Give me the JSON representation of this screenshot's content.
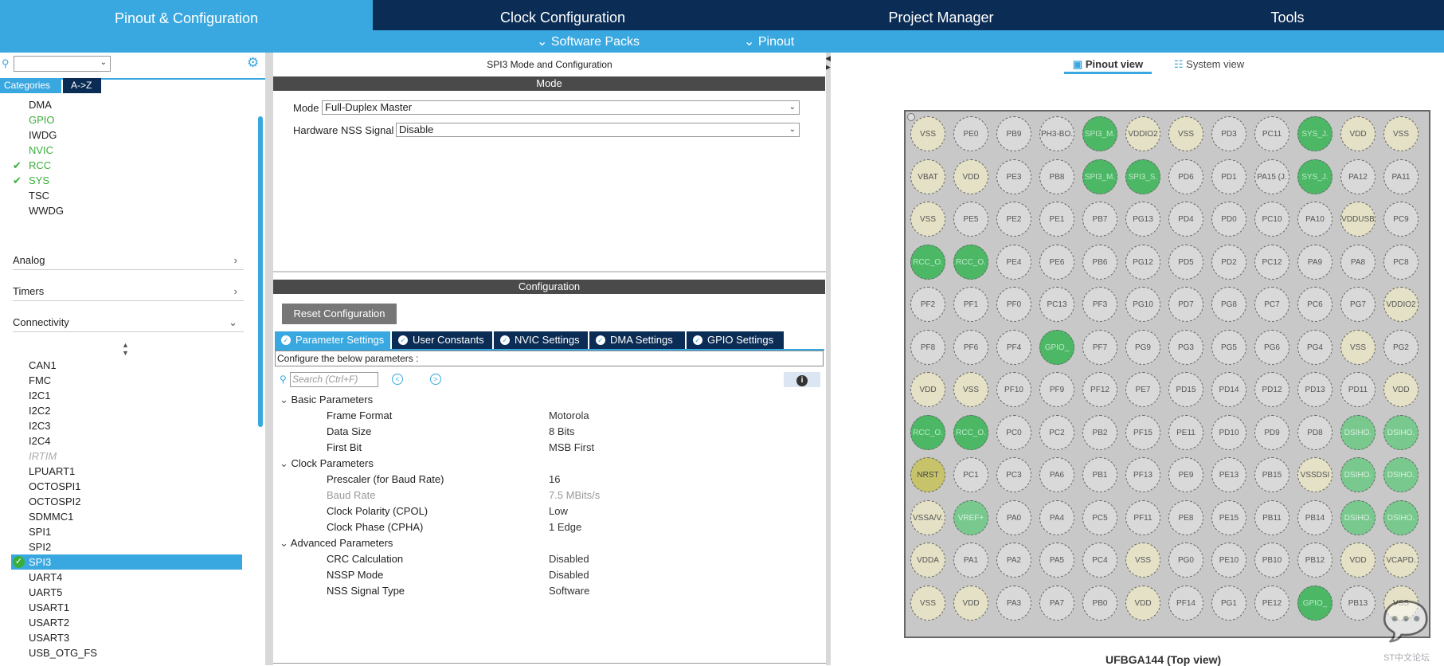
{
  "nav": {
    "tabs": [
      "Pinout & Configuration",
      "Clock Configuration",
      "Project Manager",
      "Tools"
    ],
    "sub": [
      "Software Packs",
      "Pinout"
    ]
  },
  "left": {
    "search_value": "",
    "cat_tab": "Categories",
    "az_tab": "A->Z",
    "system_items": [
      {
        "label": "DMA",
        "state": "normal"
      },
      {
        "label": "GPIO",
        "state": "green"
      },
      {
        "label": "IWDG",
        "state": "normal"
      },
      {
        "label": "NVIC",
        "state": "green"
      },
      {
        "label": "RCC",
        "state": "checked"
      },
      {
        "label": "SYS",
        "state": "checked"
      },
      {
        "label": "TSC",
        "state": "normal"
      },
      {
        "label": "WWDG",
        "state": "normal"
      }
    ],
    "sections": [
      "Analog",
      "Timers",
      "Connectivity"
    ],
    "connectivity_items": [
      {
        "label": "CAN1",
        "state": "normal"
      },
      {
        "label": "FMC",
        "state": "normal"
      },
      {
        "label": "I2C1",
        "state": "normal"
      },
      {
        "label": "I2C2",
        "state": "normal"
      },
      {
        "label": "I2C3",
        "state": "normal"
      },
      {
        "label": "I2C4",
        "state": "normal"
      },
      {
        "label": "IRTIM",
        "state": "disabled"
      },
      {
        "label": "LPUART1",
        "state": "normal"
      },
      {
        "label": "OCTOSPI1",
        "state": "normal"
      },
      {
        "label": "OCTOSPI2",
        "state": "normal"
      },
      {
        "label": "SDMMC1",
        "state": "normal"
      },
      {
        "label": "SPI1",
        "state": "normal"
      },
      {
        "label": "SPI2",
        "state": "normal"
      },
      {
        "label": "SPI3",
        "state": "selected"
      },
      {
        "label": "UART4",
        "state": "normal"
      },
      {
        "label": "UART5",
        "state": "normal"
      },
      {
        "label": "USART1",
        "state": "normal"
      },
      {
        "label": "USART2",
        "state": "normal"
      },
      {
        "label": "USART3",
        "state": "normal"
      },
      {
        "label": "USB_OTG_FS",
        "state": "normal"
      }
    ]
  },
  "mid": {
    "title": "SPI3 Mode and Configuration",
    "mode_bar": "Mode",
    "mode_label": "Mode",
    "mode_value": "Full-Duplex Master",
    "nss_label": "Hardware NSS Signal",
    "nss_value": "Disable",
    "config_bar": "Configuration",
    "reset_button": "Reset Configuration",
    "tabs": [
      "Parameter Settings",
      "User Constants",
      "NVIC Settings",
      "DMA Settings",
      "GPIO Settings"
    ],
    "configure_text": "Configure the below parameters :",
    "search_placeholder": "Search (Ctrl+F)",
    "groups": [
      {
        "name": "Basic Parameters",
        "params": [
          {
            "name": "Frame Format",
            "value": "Motorola",
            "dim": false
          },
          {
            "name": "Data Size",
            "value": "8 Bits",
            "dim": false
          },
          {
            "name": "First Bit",
            "value": "MSB First",
            "dim": false
          }
        ]
      },
      {
        "name": "Clock Parameters",
        "params": [
          {
            "name": "Prescaler (for Baud Rate)",
            "value": "16",
            "dim": false
          },
          {
            "name": "Baud Rate",
            "value": "7.5 MBits/s",
            "dim": true
          },
          {
            "name": "Clock Polarity (CPOL)",
            "value": "Low",
            "dim": false
          },
          {
            "name": "Clock Phase (CPHA)",
            "value": "1 Edge",
            "dim": false
          }
        ]
      },
      {
        "name": "Advanced Parameters",
        "params": [
          {
            "name": "CRC Calculation",
            "value": "Disabled",
            "dim": false
          },
          {
            "name": "NSSP Mode",
            "value": "Disabled",
            "dim": false
          },
          {
            "name": "NSS Signal Type",
            "value": "Software",
            "dim": false
          }
        ]
      }
    ]
  },
  "right": {
    "pinout_view": "Pinout view",
    "system_view": "System view",
    "package_label": "UFBGA144 (Top view)",
    "watermark": "ST中文论坛",
    "pins": [
      [
        [
          "VSS",
          "y"
        ],
        [
          "PE0",
          "g"
        ],
        [
          "PB9",
          "g"
        ],
        [
          "PH3-BO.",
          "g"
        ],
        [
          "SPI3_M.",
          "s"
        ],
        [
          "VDDIO2",
          "y"
        ],
        [
          "VSS",
          "y"
        ],
        [
          "PD3",
          "g"
        ],
        [
          "PC11",
          "g"
        ],
        [
          "SYS_J.",
          "s"
        ],
        [
          "VDD",
          "y"
        ],
        [
          "VSS",
          "y"
        ]
      ],
      [
        [
          "VBAT",
          "y"
        ],
        [
          "VDD",
          "y"
        ],
        [
          "PE3",
          "g"
        ],
        [
          "PB8",
          "g"
        ],
        [
          "SPI3_M.",
          "s"
        ],
        [
          "SPI3_S.",
          "s"
        ],
        [
          "PD6",
          "g"
        ],
        [
          "PD1",
          "g"
        ],
        [
          "PA15 (J.",
          "g"
        ],
        [
          "SYS_J.",
          "s"
        ],
        [
          "PA12",
          "g"
        ],
        [
          "PA11",
          "g"
        ]
      ],
      [
        [
          "VSS",
          "y"
        ],
        [
          "PE5",
          "g"
        ],
        [
          "PE2",
          "g"
        ],
        [
          "PE1",
          "g"
        ],
        [
          "PB7",
          "g"
        ],
        [
          "PG13",
          "g"
        ],
        [
          "PD4",
          "g"
        ],
        [
          "PD0",
          "g"
        ],
        [
          "PC10",
          "g"
        ],
        [
          "PA10",
          "g"
        ],
        [
          "VDDUSB",
          "y"
        ],
        [
          "PC9",
          "g"
        ]
      ],
      [
        [
          "RCC_O.",
          "s"
        ],
        [
          "RCC_O.",
          "s"
        ],
        [
          "PE4",
          "g"
        ],
        [
          "PE6",
          "g"
        ],
        [
          "PB6",
          "g"
        ],
        [
          "PG12",
          "g"
        ],
        [
          "PD5",
          "g"
        ],
        [
          "PD2",
          "g"
        ],
        [
          "PC12",
          "g"
        ],
        [
          "PA9",
          "g"
        ],
        [
          "PA8",
          "g"
        ],
        [
          "PC8",
          "g"
        ]
      ],
      [
        [
          "PF2",
          "g"
        ],
        [
          "PF1",
          "g"
        ],
        [
          "PF0",
          "g"
        ],
        [
          "PC13",
          "g"
        ],
        [
          "PF3",
          "g"
        ],
        [
          "PG10",
          "g"
        ],
        [
          "PD7",
          "g"
        ],
        [
          "PG8",
          "g"
        ],
        [
          "PC7",
          "g"
        ],
        [
          "PC6",
          "g"
        ],
        [
          "PG7",
          "g"
        ],
        [
          "VDDIO2",
          "y"
        ]
      ],
      [
        [
          "PF8",
          "g"
        ],
        [
          "PF6",
          "g"
        ],
        [
          "PF4",
          "g"
        ],
        [
          "GPIO_",
          "s"
        ],
        [
          "PF7",
          "g"
        ],
        [
          "PG9",
          "g"
        ],
        [
          "PG3",
          "g"
        ],
        [
          "PG5",
          "g"
        ],
        [
          "PG6",
          "g"
        ],
        [
          "PG4",
          "g"
        ],
        [
          "VSS",
          "y"
        ],
        [
          "PG2",
          "g"
        ]
      ],
      [
        [
          "VDD",
          "y"
        ],
        [
          "VSS",
          "y"
        ],
        [
          "PF10",
          "g"
        ],
        [
          "PF9",
          "g"
        ],
        [
          "PF12",
          "g"
        ],
        [
          "PE7",
          "g"
        ],
        [
          "PD15",
          "g"
        ],
        [
          "PD14",
          "g"
        ],
        [
          "PD12",
          "g"
        ],
        [
          "PD13",
          "g"
        ],
        [
          "PD11",
          "g"
        ],
        [
          "VDD",
          "y"
        ]
      ],
      [
        [
          "RCC_O.",
          "s"
        ],
        [
          "RCC_O.",
          "s"
        ],
        [
          "PC0",
          "g"
        ],
        [
          "PC2",
          "g"
        ],
        [
          "PB2",
          "g"
        ],
        [
          "PF15",
          "g"
        ],
        [
          "PE11",
          "g"
        ],
        [
          "PD10",
          "g"
        ],
        [
          "PD9",
          "g"
        ],
        [
          "PD8",
          "g"
        ],
        [
          "DSIHO.",
          "l"
        ],
        [
          "DSIHO.",
          "l"
        ]
      ],
      [
        [
          "NRST",
          "o"
        ],
        [
          "PC1",
          "g"
        ],
        [
          "PC3",
          "g"
        ],
        [
          "PA6",
          "g"
        ],
        [
          "PB1",
          "g"
        ],
        [
          "PF13",
          "g"
        ],
        [
          "PE9",
          "g"
        ],
        [
          "PE13",
          "g"
        ],
        [
          "PB15",
          "g"
        ],
        [
          "VSSDSI",
          "y"
        ],
        [
          "DSIHO.",
          "l"
        ],
        [
          "DSIHO.",
          "l"
        ]
      ],
      [
        [
          "VSSA/V.",
          "y"
        ],
        [
          "VREF+",
          "l"
        ],
        [
          "PA0",
          "g"
        ],
        [
          "PA4",
          "g"
        ],
        [
          "PC5",
          "g"
        ],
        [
          "PF11",
          "g"
        ],
        [
          "PE8",
          "g"
        ],
        [
          "PE15",
          "g"
        ],
        [
          "PB11",
          "g"
        ],
        [
          "PB14",
          "g"
        ],
        [
          "DSIHO.",
          "l"
        ],
        [
          "DSIHO.",
          "l"
        ]
      ],
      [
        [
          "VDDA",
          "y"
        ],
        [
          "PA1",
          "g"
        ],
        [
          "PA2",
          "g"
        ],
        [
          "PA5",
          "g"
        ],
        [
          "PC4",
          "g"
        ],
        [
          "VSS",
          "y"
        ],
        [
          "PG0",
          "g"
        ],
        [
          "PE10",
          "g"
        ],
        [
          "PB10",
          "g"
        ],
        [
          "PB12",
          "g"
        ],
        [
          "VDD",
          "y"
        ],
        [
          "VCAPD.",
          "y"
        ]
      ],
      [
        [
          "VSS",
          "y"
        ],
        [
          "VDD",
          "y"
        ],
        [
          "PA3",
          "g"
        ],
        [
          "PA7",
          "g"
        ],
        [
          "PB0",
          "g"
        ],
        [
          "VDD",
          "y"
        ],
        [
          "PF14",
          "g"
        ],
        [
          "PG1",
          "g"
        ],
        [
          "PE12",
          "g"
        ],
        [
          "GPIO_",
          "s"
        ],
        [
          "PB13",
          "g"
        ],
        [
          "VSS",
          "y"
        ]
      ]
    ]
  }
}
